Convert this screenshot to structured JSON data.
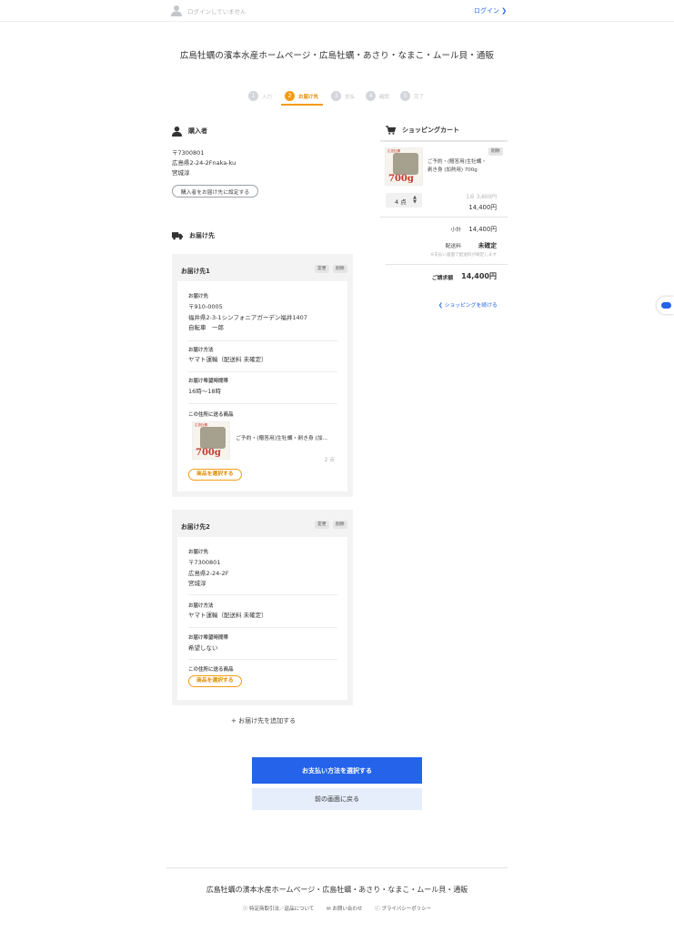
{
  "topbar": {
    "status": "ログインしていません",
    "login": "ログイン ❯"
  },
  "site_title": "広島牡蠣の濱本水産ホームページ・広島牡蠣・あさり・なまこ・ムール貝・通販",
  "steps": [
    {
      "num": "1",
      "label": "入力"
    },
    {
      "num": "2",
      "label": "お届け先"
    },
    {
      "num": "3",
      "label": "支払"
    },
    {
      "num": "4",
      "label": "確認"
    },
    {
      "num": "5",
      "label": "完了"
    }
  ],
  "buyer": {
    "title": "購入者",
    "lines": [
      "〒7300801",
      "広島県2-24-2Fnaka-ku",
      "宮城淳"
    ],
    "set_button": "購入者をお届け先に設定する"
  },
  "delivery": {
    "title": "お届け先",
    "cards": [
      {
        "title": "お届け先1",
        "edit": "変更",
        "delete": "削除",
        "address_label": "お届け先",
        "address_lines": [
          "〒910-0005",
          "福井県2-3-1シンフォニアガーデン福井1407",
          "自転車　一郎"
        ],
        "method_label": "お届け方法",
        "method": "ヤマト運輸（配送料 未確定）",
        "time_label": "お届け希望時間帯",
        "time": "16時〜18時",
        "items_label": "この住所に送る商品",
        "item_name": "ご予約・(贈答用)生牡蠣・剥き身 (加...",
        "item_qty": "2 点",
        "select_button": "商品を選択する"
      },
      {
        "title": "お届け先2",
        "edit": "変更",
        "delete": "削除",
        "address_label": "お届け先",
        "address_lines": [
          "〒7300801",
          "広島県2-24-2F",
          "宮城淳"
        ],
        "method_label": "お届け方法",
        "method": "ヤマト運輸（配送料 未確定）",
        "time_label": "お届け希望時間帯",
        "time": "希望しない",
        "items_label": "この住所に送る商品",
        "select_button": "商品を選択する"
      }
    ],
    "add": "+ お届け先を追加する"
  },
  "product_image": {
    "top": "広島牡蠣",
    "price": "700g"
  },
  "cart": {
    "title": "ショッピングカート",
    "delete": "削除",
    "product_name": "ご予約・(贈答用)生牡蠣・剥き身 (加熱用) 700g",
    "qty": "4 点",
    "unit_price": "1点 3,600円",
    "line_total": "14,400円",
    "subtotal_label": "小計",
    "subtotal": "14,400円",
    "shipping_label": "配送料",
    "shipping": "未確定",
    "shipping_note": "※支払い画面で配送料が確定します",
    "total_label": "ご請求額",
    "total": "14,400円",
    "continue": "❮ ショッピングを続ける"
  },
  "actions": {
    "primary": "お支払い方法を選択する",
    "back": "前の画面に戻る"
  },
  "footer": {
    "title": "広島牡蠣の濱本水産ホームページ・広島牡蠣・あさり・なまこ・ムール貝・通販",
    "links": [
      "ⓘ 特定商取引法／返品について",
      "✉ お問い合わせ",
      "ⓘ プライバシーポリシー"
    ]
  },
  "colors": {
    "accent": "#2563eb",
    "step_active": "#f39c12"
  }
}
